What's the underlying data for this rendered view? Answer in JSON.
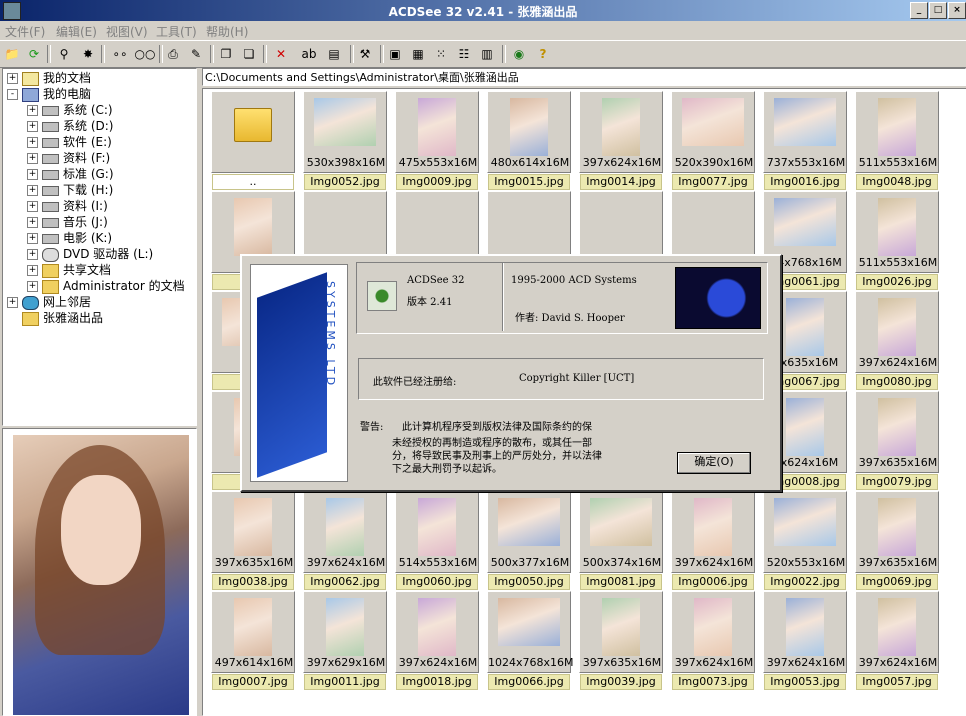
{
  "window": {
    "title": "ACDSee 32 v2.41 - 张雅涵出品"
  },
  "menu": [
    "文件(F)",
    "编辑(E)",
    "视图(V)",
    "工具(T)",
    "帮助(H)"
  ],
  "tree": [
    {
      "label": "我的文档",
      "icon": "docs-icon",
      "indent": 0,
      "expander": "+"
    },
    {
      "label": "我的电脑",
      "icon": "computer-icon",
      "indent": 0,
      "expander": "-"
    },
    {
      "label": "系统 (C:)",
      "icon": "drive-icon",
      "indent": 1,
      "expander": "+"
    },
    {
      "label": "系统 (D:)",
      "icon": "drive-icon",
      "indent": 1,
      "expander": "+"
    },
    {
      "label": "软件 (E:)",
      "icon": "drive-icon",
      "indent": 1,
      "expander": "+"
    },
    {
      "label": "资料 (F:)",
      "icon": "drive-icon",
      "indent": 1,
      "expander": "+"
    },
    {
      "label": "标准 (G:)",
      "icon": "drive-icon",
      "indent": 1,
      "expander": "+"
    },
    {
      "label": "下载 (H:)",
      "icon": "drive-icon",
      "indent": 1,
      "expander": "+"
    },
    {
      "label": "资料 (I:)",
      "icon": "drive-icon",
      "indent": 1,
      "expander": "+"
    },
    {
      "label": "音乐 (J:)",
      "icon": "drive-icon",
      "indent": 1,
      "expander": "+"
    },
    {
      "label": "电影 (K:)",
      "icon": "drive-icon",
      "indent": 1,
      "expander": "+"
    },
    {
      "label": "DVD 驱动器 (L:)",
      "icon": "dvd-icon",
      "indent": 1,
      "expander": "+"
    },
    {
      "label": "共享文档",
      "icon": "folder-icon",
      "indent": 1,
      "expander": "+"
    },
    {
      "label": "Administrator 的文档",
      "icon": "folder-icon",
      "indent": 1,
      "expander": "+"
    },
    {
      "label": "网上邻居",
      "icon": "network-icon",
      "indent": 0,
      "expander": "+"
    },
    {
      "label": "张雅涵出品",
      "icon": "folder-icon",
      "indent": 0,
      "expander": ""
    }
  ],
  "address": "C:\\Documents and Settings\\Administrator\\桌面\\张雅涵出品",
  "thumbnails": [
    {
      "dim": "",
      "name": "..",
      "folder": true
    },
    {
      "dim": "530x398x16M",
      "name": "Img0052.jpg"
    },
    {
      "dim": "475x553x16M",
      "name": "Img0009.jpg"
    },
    {
      "dim": "480x614x16M",
      "name": "Img0015.jpg"
    },
    {
      "dim": "397x624x16M",
      "name": "Img0014.jpg"
    },
    {
      "dim": "520x390x16M",
      "name": "Img0077.jpg"
    },
    {
      "dim": "737x553x16M",
      "name": "Img0016.jpg"
    },
    {
      "dim": "511x553x16M",
      "name": "Img0048.jpg"
    },
    {
      "dim": "397x",
      "name": "Img"
    },
    {
      "dim": "",
      "name": ""
    },
    {
      "dim": "",
      "name": ""
    },
    {
      "dim": "",
      "name": ""
    },
    {
      "dim": "",
      "name": ""
    },
    {
      "dim": "",
      "name": ""
    },
    {
      "dim": "24x768x16M",
      "name": "Img0061.jpg"
    },
    {
      "dim": "511x553x16M",
      "name": "Img0026.jpg"
    },
    {
      "dim": "520x",
      "name": "Img"
    },
    {
      "dim": "",
      "name": ""
    },
    {
      "dim": "",
      "name": ""
    },
    {
      "dim": "",
      "name": ""
    },
    {
      "dim": "",
      "name": ""
    },
    {
      "dim": "",
      "name": ""
    },
    {
      "dim": "7x635x16M",
      "name": "Img0067.jpg"
    },
    {
      "dim": "397x624x16M",
      "name": "Img0080.jpg"
    },
    {
      "dim": "397x",
      "name": "Img"
    },
    {
      "dim": "",
      "name": ""
    },
    {
      "dim": "",
      "name": ""
    },
    {
      "dim": "",
      "name": ""
    },
    {
      "dim": "",
      "name": ""
    },
    {
      "dim": "",
      "name": ""
    },
    {
      "dim": "7x624x16M",
      "name": "Img0008.jpg"
    },
    {
      "dim": "397x635x16M",
      "name": "Img0079.jpg"
    },
    {
      "dim": "397x635x16M",
      "name": "Img0038.jpg"
    },
    {
      "dim": "397x624x16M",
      "name": "Img0062.jpg"
    },
    {
      "dim": "514x553x16M",
      "name": "Img0060.jpg"
    },
    {
      "dim": "500x377x16M",
      "name": "Img0050.jpg"
    },
    {
      "dim": "500x374x16M",
      "name": "Img0081.jpg"
    },
    {
      "dim": "397x624x16M",
      "name": "Img0006.jpg"
    },
    {
      "dim": "520x553x16M",
      "name": "Img0022.jpg"
    },
    {
      "dim": "397x635x16M",
      "name": "Img0069.jpg"
    },
    {
      "dim": "497x614x16M",
      "name": "Img0007.jpg"
    },
    {
      "dim": "397x629x16M",
      "name": "Img0011.jpg"
    },
    {
      "dim": "397x624x16M",
      "name": "Img0018.jpg"
    },
    {
      "dim": "1024x768x16M",
      "name": "Img0066.jpg"
    },
    {
      "dim": "397x635x16M",
      "name": "Img0039.jpg"
    },
    {
      "dim": "397x624x16M",
      "name": "Img0073.jpg"
    },
    {
      "dim": "397x624x16M",
      "name": "Img0053.jpg"
    },
    {
      "dim": "397x624x16M",
      "name": "Img0057.jpg"
    }
  ],
  "about": {
    "product": "ACDSee 32",
    "version": "版本 2.41",
    "copyright": "1995-2000 ACD Systems",
    "author": "作者: David S. Hooper",
    "registered_label": "此软件已经注册给:",
    "registered_to": "Copyright Killer [UCT]",
    "warning_label": "警告:",
    "warning_line1": "此计算机程序受到版权法律及国际条约的保",
    "warning_line2": "未经授权的再制造或程序的散布，或其任一部",
    "warning_line3": "分，将导致民事及刑事上的严厉处分，并以法律",
    "warning_line4": "下之最大刑罚予以起诉。",
    "ok": "确定(O)",
    "logo_text": "SYSTEMS LTD"
  }
}
